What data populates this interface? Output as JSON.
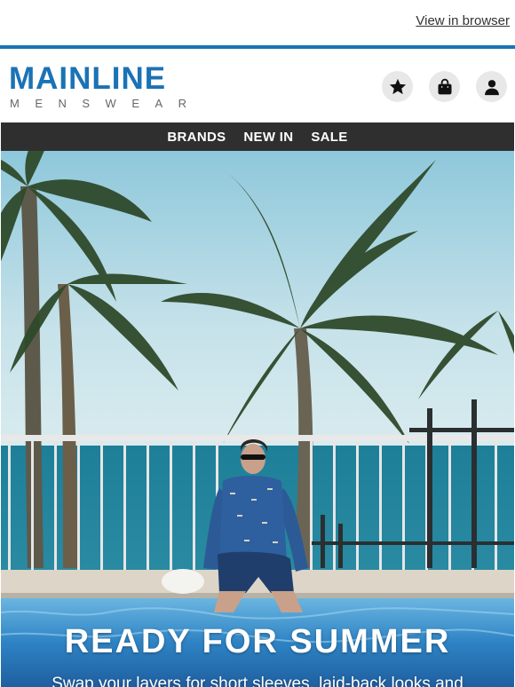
{
  "topbar": {
    "view_in_browser": "View in browser"
  },
  "brand": {
    "name": "MAINLINE",
    "tagline": "MENSWEAR",
    "color": "#1a73b4"
  },
  "header_icons": [
    {
      "name": "wishlist",
      "icon": "star-icon"
    },
    {
      "name": "bag",
      "icon": "shopping-bag-icon"
    },
    {
      "name": "account",
      "icon": "user-icon"
    }
  ],
  "nav": {
    "items": [
      "BRANDS",
      "NEW IN",
      "SALE"
    ]
  },
  "hero": {
    "title": "READY FOR SUMMER",
    "text": "Swap your layers for short sleeves, laid-back looks and"
  }
}
